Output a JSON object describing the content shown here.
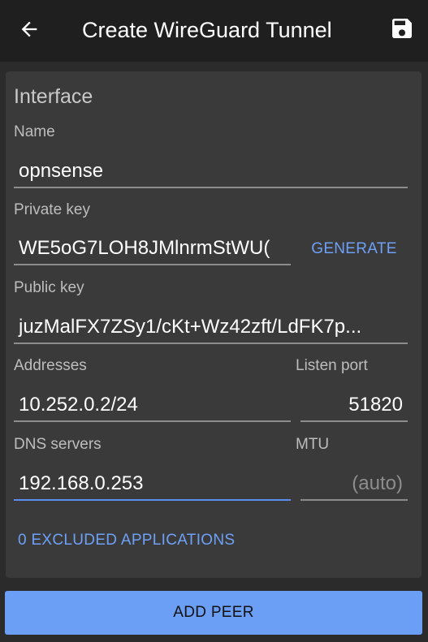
{
  "appbar": {
    "title": "Create WireGuard Tunnel",
    "back_icon": "arrow-left-icon",
    "save_icon": "floppy-disk-icon"
  },
  "interface": {
    "section_title": "Interface",
    "name": {
      "label": "Name",
      "value": "opnsense"
    },
    "private_key": {
      "label": "Private key",
      "value": "WE5oG7LOH8JMlnrmStWU(",
      "generate_label": "GENERATE"
    },
    "public_key": {
      "label": "Public key",
      "value": "juzMalFX7ZSy1/cKt+Wz42zft/LdFK7p..."
    },
    "addresses": {
      "label": "Addresses",
      "value": "10.252.0.2/24"
    },
    "listen_port": {
      "label": "Listen port",
      "value": "51820"
    },
    "dns_servers": {
      "label": "DNS servers",
      "value": "192.168.0.253"
    },
    "mtu": {
      "label": "MTU",
      "placeholder": "(auto)"
    },
    "excluded_apps_label": "0 EXCLUDED APPLICATIONS"
  },
  "add_peer_label": "ADD PEER",
  "colors": {
    "accent": "#6ea0f6",
    "button": "#6b9ff5",
    "card": "#3a3a3a",
    "appbar": "#1f1f1f",
    "focus_underline": "#5c8ef0"
  }
}
